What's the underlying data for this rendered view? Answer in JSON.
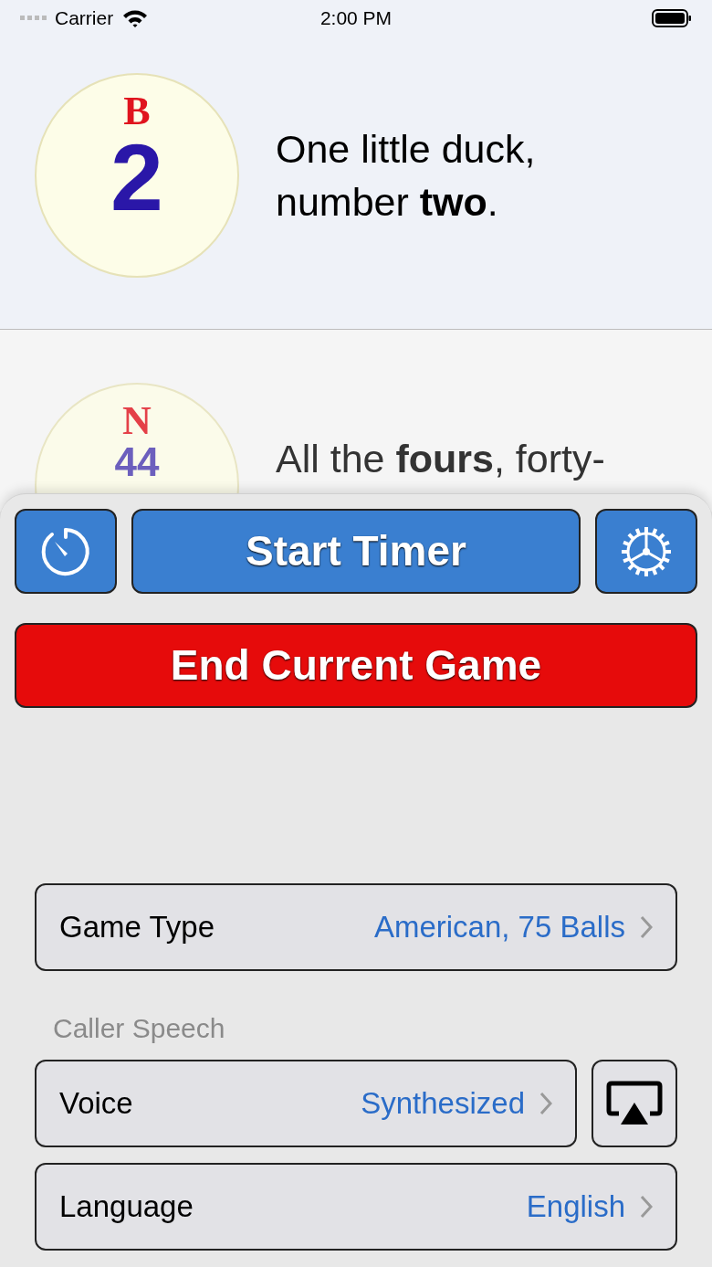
{
  "status_bar": {
    "carrier": "Carrier",
    "time": "2:00 PM"
  },
  "calls": [
    {
      "letter": "B",
      "number": "2",
      "phrase": "One little duck,\nnumber **two**.",
      "current": true
    },
    {
      "letter": "N",
      "number": "44",
      "phrase": "All the **fours**, forty-",
      "current": false
    }
  ],
  "toolbar": [
    {
      "kind": "timer"
    },
    {
      "kind": "label",
      "label": "Start Timer"
    },
    {
      "kind": "settings"
    }
  ],
  "end_button": "End Current Game",
  "settings": [
    {
      "kind": "row",
      "label": "Game Type",
      "value": "American, 75 Balls"
    },
    {
      "kind": "header",
      "label": "Caller Speech"
    },
    {
      "kind": "row",
      "label": "Voice",
      "value": "Synthesized",
      "airplay": true
    },
    {
      "kind": "row",
      "label": "Language",
      "value": "English"
    }
  ]
}
